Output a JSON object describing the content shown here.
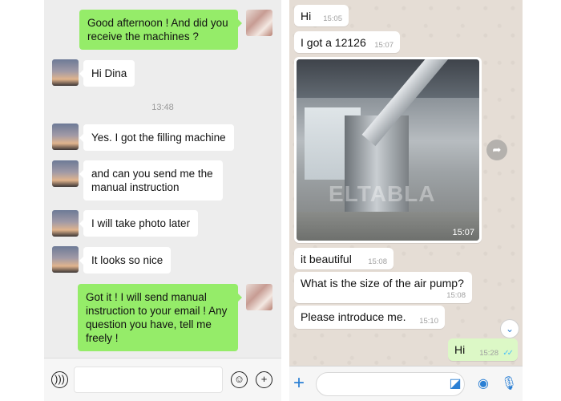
{
  "left_chat": {
    "messages": [
      {
        "dir": "out",
        "text": "Good afternoon ! And did you receive the machines ?"
      },
      {
        "dir": "in",
        "text": "Hi Dina"
      },
      {
        "dir": "in",
        "text": "Yes. I got the filling machine"
      },
      {
        "dir": "in",
        "text": "and can you send me the manual instruction"
      },
      {
        "dir": "in",
        "text": "I will take photo later"
      },
      {
        "dir": "in",
        "text": "It looks so nice"
      },
      {
        "dir": "out",
        "text": "Got it ! I will send manual instruction to your email ! Any question you have, tell me freely !"
      }
    ],
    "timestamp": "13:48",
    "input_bar": {
      "voice_icon": "voice-icon",
      "emoji_icon": "emoji-icon",
      "add_icon": "plus-circle-icon"
    }
  },
  "right_chat": {
    "messages": [
      {
        "dir": "in",
        "text": "Hi",
        "time": "15:05"
      },
      {
        "dir": "in",
        "text": "I got a 12126",
        "time": "15:07"
      },
      {
        "dir": "in",
        "type": "photo",
        "time": "15:07",
        "watermark": "ELTABLA"
      },
      {
        "dir": "in",
        "text": "it beautiful",
        "time": "15:08"
      },
      {
        "dir": "in",
        "text": "What is the size of the air pump?",
        "time": "15:08"
      },
      {
        "dir": "in",
        "text": "Please introduce me.",
        "time": "15:10"
      },
      {
        "dir": "out",
        "text": "Hi",
        "time": "15:28",
        "status": "read"
      }
    ],
    "input_bar": {
      "plus_icon": "plus-icon",
      "sticker_icon": "sticker-icon",
      "camera_icon": "camera-icon",
      "mic_icon": "microphone-icon"
    }
  },
  "colors": {
    "wechat_out": "#95ec69",
    "wechat_bg": "#ededed",
    "whatsapp_bg": "#e5ddd5",
    "whatsapp_out": "#dcf8c6",
    "accent_blue": "#2a7fd4"
  }
}
